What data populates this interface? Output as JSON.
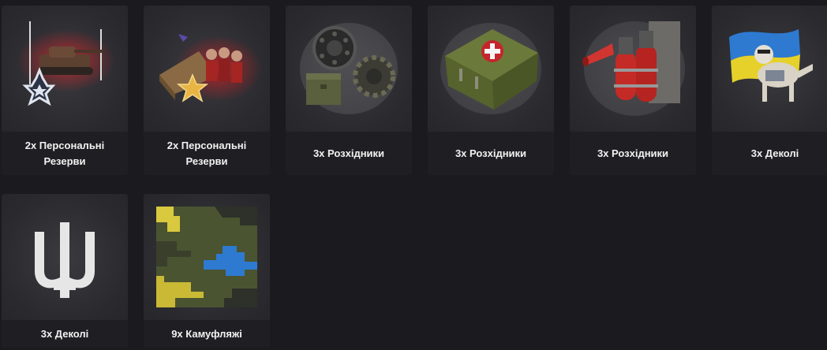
{
  "rewards": [
    {
      "label": "2х Персональні Резерви",
      "icon": "personal-reserve-tank-star-icon"
    },
    {
      "label": "2х Персональні Резерви",
      "icon": "personal-reserve-crew-star-icon"
    },
    {
      "label": "3х Розхідники",
      "icon": "consumables-wheel-track-icon"
    },
    {
      "label": "3х Розхідники",
      "icon": "consumables-first-aid-kit-icon"
    },
    {
      "label": "3х Розхідники",
      "icon": "consumables-fire-extinguisher-icon"
    },
    {
      "label": "3х Деколі",
      "icon": "decal-dog-flag-icon"
    },
    {
      "label": "3х Деколі",
      "icon": "decal-trident-icon"
    },
    {
      "label": "9х Камуфляжі",
      "icon": "camouflage-pattern-icon"
    }
  ],
  "colors": {
    "background": "#1b1b1f",
    "card": "#222226",
    "label_text": "#f2f2f2",
    "ukraine_blue": "#2e7ad1",
    "ukraine_yellow": "#e6d12b"
  }
}
